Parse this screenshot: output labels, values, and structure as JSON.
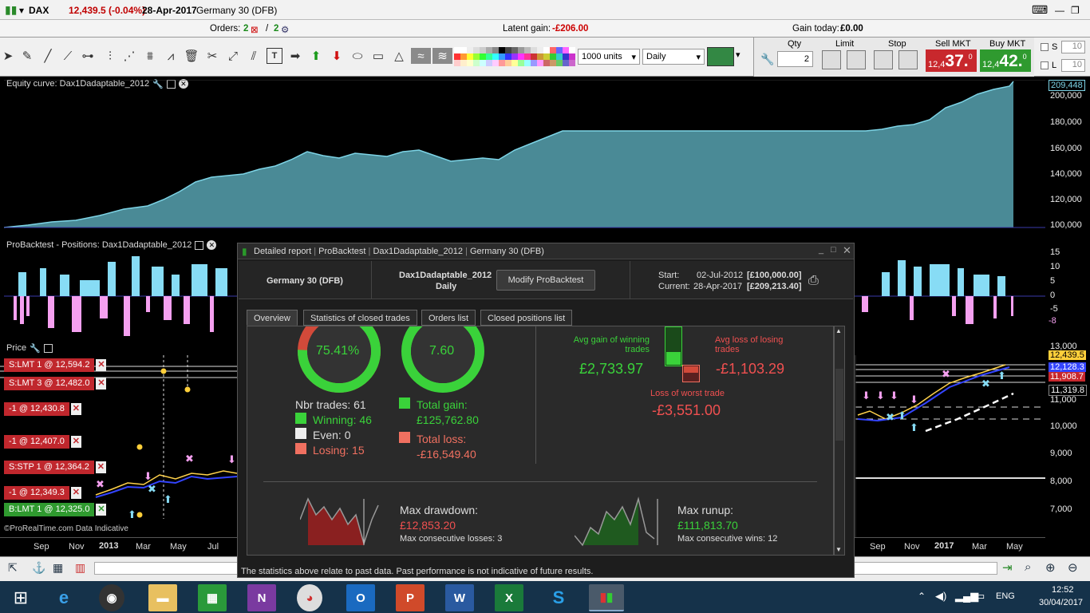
{
  "window": {
    "symbol": "DAX",
    "price": "12,439.5 (-0.04%)",
    "date": "28-Apr-2017",
    "instrument": "Germany 30 (DFB)"
  },
  "status": {
    "orders_label": "Orders:",
    "orders_a": "2",
    "orders_sep": "/",
    "orders_b": "2",
    "latent_label": "Latent gain:",
    "latent_value": "-£206.00",
    "gaintoday_label": "Gain today:",
    "gaintoday_value": "£0.00"
  },
  "toolbar": {
    "units": "1000 units",
    "period": "Daily",
    "qty_label": "Qty",
    "qty_value": "2",
    "limit_label": "Limit",
    "stop_label": "Stop",
    "sell_label": "Sell MKT",
    "buy_label": "Buy MKT",
    "sell_prefix": "12,4",
    "sell_big": "37.",
    "sell_sup": "0",
    "buy_prefix": "12,4",
    "buy_big": "42.",
    "buy_sup": "0",
    "s_label": "S",
    "l_label": "L",
    "s_value": "10",
    "l_value": "10"
  },
  "equity": {
    "title": "Equity curve: Dax1Dadaptable_2012",
    "current": "209,448",
    "ticks": [
      "200,000",
      "180,000",
      "160,000",
      "140,000",
      "120,000",
      "100,000"
    ]
  },
  "positions": {
    "title": "ProBacktest - Positions: Dax1Dadaptable_2012",
    "ticks": [
      "15",
      "10",
      "5",
      "0",
      "-5",
      "-8"
    ]
  },
  "price": {
    "title": "Price",
    "ticks": [
      "13,000",
      "11,000",
      "10,000",
      "9,000",
      "8,000",
      "7,000"
    ],
    "badges": [
      "12,439.5",
      "12,128.3",
      "11,908.7",
      "11,319.8"
    ],
    "orders": [
      {
        "label": "S:LMT  1 @ 12,594.2"
      },
      {
        "label": "S:LMT  3 @ 12,482.0"
      },
      {
        "label": "-1 @ 12,430.8"
      },
      {
        "label": "-1 @ 12,407.0"
      },
      {
        "label": "S:STP  1 @ 12,364.2"
      },
      {
        "label": "-1 @ 12,349.3"
      },
      {
        "label": "B:LMT  1 @ 12,325.0"
      }
    ],
    "months_left": [
      "Sep",
      "Nov",
      "2013",
      "Mar",
      "May",
      "Jul"
    ],
    "months_right": [
      "Sep",
      "Nov",
      "2017",
      "Mar",
      "May"
    ],
    "footer": "©ProRealTime.com Data Indicative"
  },
  "report": {
    "title": "Detailed report",
    "title_parts": [
      "ProBacktest",
      "Dax1Dadaptable_2012",
      "Germany 30 (DFB)"
    ],
    "instrument": "Germany 30 (DFB)",
    "system": "Dax1Dadaptable_2012",
    "period": "Daily",
    "modify": "Modify ProBacktest",
    "start_label": "Start:",
    "start_date": "02-Jul-2012",
    "start_cap": "[£100,000.00]",
    "current_label": "Current:",
    "current_date": "28-Apr-2017",
    "current_cap": "[£209,213.40]",
    "tabs": [
      "Overview",
      "Statistics of closed trades",
      "Orders list",
      "Closed positions list"
    ],
    "pct_win": "75.41%",
    "ratio": "7.60",
    "nbr_trades": "Nbr trades: 61",
    "winning": "Winning: 46",
    "even": "Even: 0",
    "losing": "Losing: 15",
    "total_gain_label": "Total gain:",
    "total_gain": "£125,762.80",
    "total_loss_label": "Total loss:",
    "total_loss": "-£16,549.40",
    "avg_gain_label": "Avg gain of winning trades",
    "avg_gain": "£2,733.97",
    "avg_loss_label": "Avg loss of losing trades",
    "avg_loss": "-£1,103.29",
    "worst_label": "Loss of worst trade",
    "worst": "-£3,551.00",
    "max_dd_label": "Max drawdown:",
    "max_dd": "£12,853.20",
    "max_consec_losses": "Max consecutive losses: 3",
    "max_ru_label": "Max runup:",
    "max_ru": "£111,813.70",
    "max_consec_wins": "Max consecutive wins: 12",
    "disclaimer": "The statistics above relate to past data. Past performance is not indicative of future results.",
    "win_fraction": 0.7541,
    "ratio_fraction": 0.9
  },
  "taskbar": {
    "time": "12:52",
    "date": "30/04/2017",
    "lang": "ENG"
  },
  "colors": {
    "accent_green": "#2fb52f",
    "accent_red": "#d23232",
    "equity_fill": "#4a8a96",
    "pos_blue": "#87dcf5",
    "pos_pink": "#f5a0f0"
  }
}
